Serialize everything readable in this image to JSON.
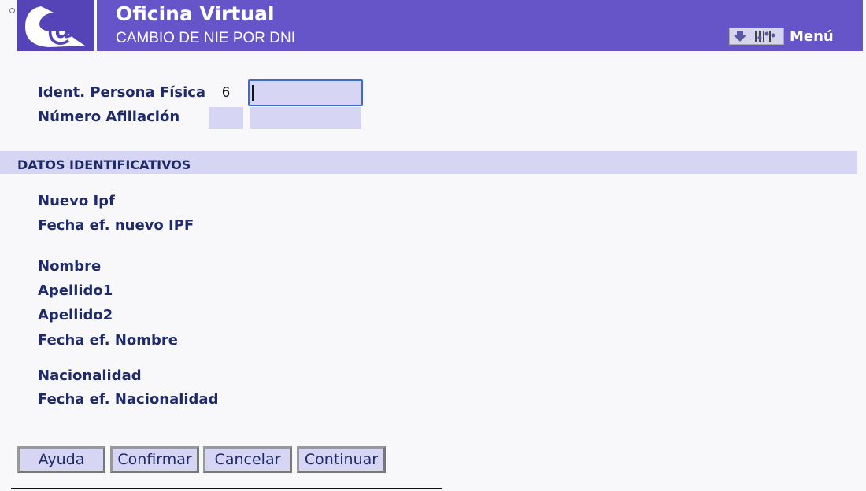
{
  "header": {
    "title": "Oficina Virtual",
    "subtitle": "CAMBIO DE NIE POR DNI",
    "menu_label": "Menú",
    "logo_icon": "at-sign-logo",
    "brand_color": "#6655c8"
  },
  "form": {
    "ipf_label": "Ident. Persona Física",
    "ipf_prefix": "6",
    "ipf_value": "",
    "afiliacion_label": "Número Afiliación"
  },
  "section": {
    "title": "DATOS IDENTIFICATIVOS",
    "labels": {
      "nuevo_ipf": "Nuevo Ipf",
      "fecha_nuevo_ipf": "Fecha ef. nuevo IPF",
      "nombre": "Nombre",
      "apellido1": "Apellido1",
      "apellido2": "Apellido2",
      "fecha_nombre": "Fecha ef. Nombre",
      "nacionalidad": "Nacionalidad",
      "fecha_nacionalidad": "Fecha ef. Nacionalidad"
    }
  },
  "buttons": {
    "ayuda": "Ayuda",
    "confirmar": "Confirmar",
    "cancelar": "Cancelar",
    "continuar": "Continuar"
  }
}
